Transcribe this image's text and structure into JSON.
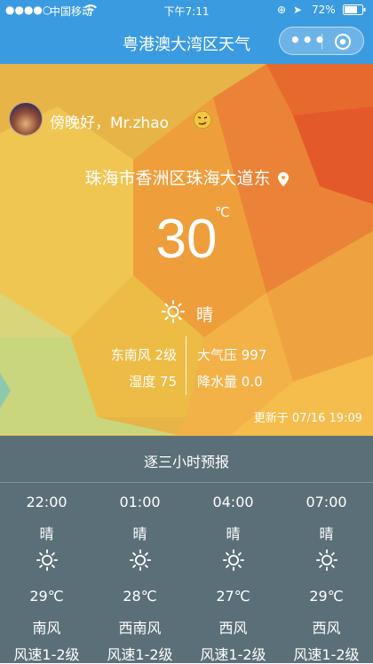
{
  "status_bar": {
    "carrier": "中国移动",
    "time": "下午7:11",
    "battery": "72%"
  },
  "app": {
    "title": "粤港澳大湾区天气"
  },
  "colors": {
    "accent": "#3b9be0",
    "panel": "#3c5f82"
  },
  "greeting": {
    "text": "傍晚好，Mr.zhao"
  },
  "location": {
    "name": "珠海市香洲区珠海大道东"
  },
  "current": {
    "temperature": "30",
    "unit": "℃",
    "condition": "晴",
    "wind": "东南风 2级",
    "humidity": "湿度 75",
    "pressure": "大气压 997",
    "precipitation": "降水量 0.0",
    "updated": "更新于 07/16 19:09"
  },
  "forecast": {
    "title": "逐三小时预报",
    "items": [
      {
        "time": "22:00",
        "condition": "晴",
        "icon": "sun-icon",
        "temp": "29℃",
        "wind_dir": "南风",
        "wind_speed": "风速1-2级"
      },
      {
        "time": "01:00",
        "condition": "晴",
        "icon": "sun-icon",
        "temp": "28℃",
        "wind_dir": "西南风",
        "wind_speed": "风速1-2级"
      },
      {
        "time": "04:00",
        "condition": "晴",
        "icon": "sun-icon",
        "temp": "27℃",
        "wind_dir": "西风",
        "wind_speed": "风速1-2级"
      },
      {
        "time": "07:00",
        "condition": "晴",
        "icon": "sun-icon",
        "temp": "29℃",
        "wind_dir": "西风",
        "wind_speed": "风速1-2级"
      }
    ]
  }
}
